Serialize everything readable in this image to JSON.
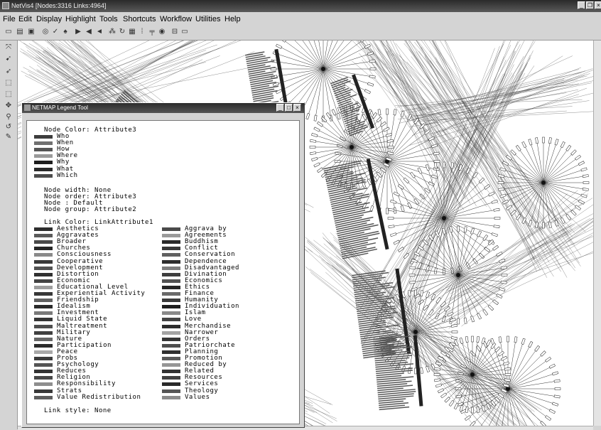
{
  "window": {
    "title": "NetVis4 [Nodes:3316 Links:4964]"
  },
  "menu": [
    "File",
    "Edit",
    "Display",
    "Highlight",
    "Tools",
    "Shortcuts",
    "Workflow",
    "Utilities",
    "Help"
  ],
  "toolbar_icons": [
    "new-icon",
    "open-icon",
    "print-icon",
    "target-icon",
    "check-icon",
    "binoculars-icon",
    "layout-right-icon",
    "layout-left-icon",
    "layout-fan-icon",
    "cluster-icon",
    "refresh-icon",
    "grid-icon",
    "dots-grid-icon",
    "tree-icon",
    "record-icon",
    "hierarchy-icon",
    "frame-icon"
  ],
  "left_tools": [
    "fit-icon",
    "pointer-icon",
    "pointer-alt-icon",
    "select-icon",
    "select-alt-icon",
    "move-icon",
    "zoom-icon",
    "rotate-icon",
    "wrench-icon"
  ],
  "legend": {
    "title": "NETMAP Legend Tool",
    "node_color_header": "Node Color: Attribute3",
    "node_colors": [
      {
        "label": "Who",
        "color": "#3d3d3d"
      },
      {
        "label": "When",
        "color": "#707070"
      },
      {
        "label": "How",
        "color": "#555555"
      },
      {
        "label": "Where",
        "color": "#9a9a9a"
      },
      {
        "label": "Why",
        "color": "#1e1e1e"
      },
      {
        "label": "What",
        "color": "#2a2a2a"
      },
      {
        "label": "Which",
        "color": "#4c4c4c"
      }
    ],
    "node_width": "Node width: None",
    "node_order": "Node order: Attribute3",
    "node_default": "Node : Default",
    "node_group": "Node group: Attribute2",
    "link_color_header": "Link Color: LinkAttribute1",
    "link_colors_left": [
      {
        "label": "Aesthetics",
        "color": "#2e2e2e"
      },
      {
        "label": "Aggravates",
        "color": "#5a5a5a"
      },
      {
        "label": "Broader",
        "color": "#4a4a4a"
      },
      {
        "label": "Churches",
        "color": "#262626"
      },
      {
        "label": "Consciousness",
        "color": "#8a8a8a"
      },
      {
        "label": "Cooperative",
        "color": "#3a3a3a"
      },
      {
        "label": "Development",
        "color": "#525252"
      },
      {
        "label": "Distortion",
        "color": "#303030"
      },
      {
        "label": "Economic",
        "color": "#444444"
      },
      {
        "label": "Educational Level",
        "color": "#9e9e9e"
      },
      {
        "label": "Experiential Activity",
        "color": "#383838"
      },
      {
        "label": "Friendship",
        "color": "#606060"
      },
      {
        "label": "Idealism",
        "color": "#2a2a2a"
      },
      {
        "label": "Investment",
        "color": "#7a7a7a"
      },
      {
        "label": "Liquid State",
        "color": "#353535"
      },
      {
        "label": "Maltreatment",
        "color": "#4e4e4e"
      },
      {
        "label": "Military",
        "color": "#404040"
      },
      {
        "label": "Nature",
        "color": "#666666"
      },
      {
        "label": "Participation",
        "color": "#2c2c2c"
      },
      {
        "label": "Peace",
        "color": "#a8a8a8"
      },
      {
        "label": "Probs",
        "color": "#3c3c3c"
      },
      {
        "label": "Psychology",
        "color": "#555555"
      },
      {
        "label": "Reduces",
        "color": "#333333"
      },
      {
        "label": "Religion",
        "color": "#484848"
      },
      {
        "label": "Responsibility",
        "color": "#8e8e8e"
      },
      {
        "label": "Strats",
        "color": "#393939"
      },
      {
        "label": "Value Redistribution",
        "color": "#5e5e5e"
      }
    ],
    "link_colors_right": [
      {
        "label": "Aggrava by",
        "color": "#4a4a4a"
      },
      {
        "label": "Agreements",
        "color": "#9a9a9a"
      },
      {
        "label": "Buddhism",
        "color": "#2a2a2a"
      },
      {
        "label": "Conflict",
        "color": "#383838"
      },
      {
        "label": "Conservation",
        "color": "#606060"
      },
      {
        "label": "Dependence",
        "color": "#2e2e2e"
      },
      {
        "label": "Disadvantaged",
        "color": "#7e7e7e"
      },
      {
        "label": "Divination",
        "color": "#3e3e3e"
      },
      {
        "label": "Economics",
        "color": "#525252"
      },
      {
        "label": "Ethics",
        "color": "#262626"
      },
      {
        "label": "Finance",
        "color": "#6a6a6a"
      },
      {
        "label": "Humanity",
        "color": "#3a3a3a"
      },
      {
        "label": "Individuation",
        "color": "#1e1e1e"
      },
      {
        "label": "Islam",
        "color": "#8a8a8a"
      },
      {
        "label": "Love",
        "color": "#444444"
      },
      {
        "label": "Merchandise",
        "color": "#2c2c2c"
      },
      {
        "label": "Narrower",
        "color": "#a4a4a4"
      },
      {
        "label": "Orders",
        "color": "#363636"
      },
      {
        "label": "Patriorchate",
        "color": "#4e4e4e"
      },
      {
        "label": "Planning",
        "color": "#303030"
      },
      {
        "label": "Promotion",
        "color": "#5a5a5a"
      },
      {
        "label": "Reduced by",
        "color": "#969696"
      },
      {
        "label": "Related",
        "color": "#333333"
      },
      {
        "label": "Resources",
        "color": "#424242"
      },
      {
        "label": "Services",
        "color": "#2a2a2a"
      },
      {
        "label": "Theology",
        "color": "#565656"
      },
      {
        "label": "Values",
        "color": "#8c8c8c"
      }
    ],
    "link_style": "Link style: None"
  }
}
